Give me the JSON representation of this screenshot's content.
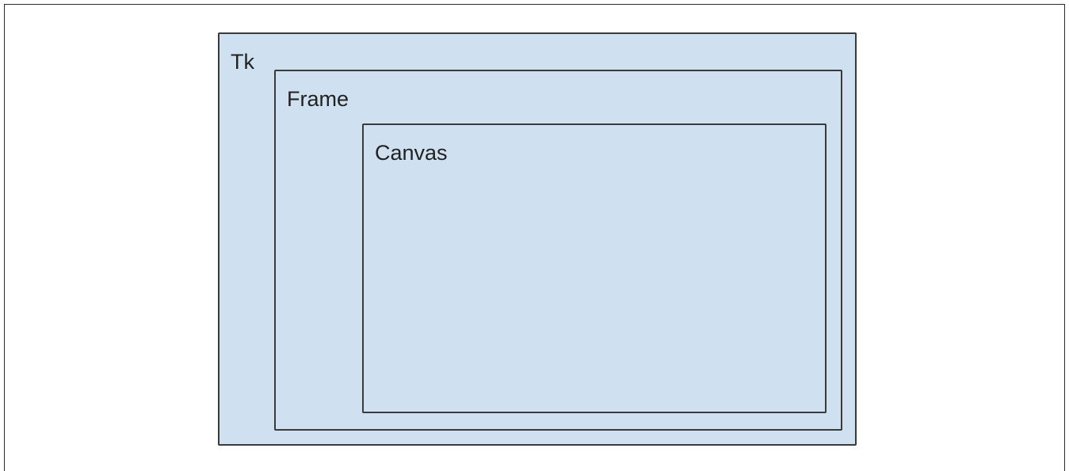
{
  "diagram": {
    "type": "nested-containers",
    "colors": {
      "box_fill": "#cfe0f1",
      "box_border": "#3a3a3a",
      "text": "#222222"
    },
    "containers": [
      {
        "id": "tk",
        "label": "Tk",
        "contains": "frame"
      },
      {
        "id": "frame",
        "label": "Frame",
        "contains": "canvas"
      },
      {
        "id": "canvas",
        "label": "Canvas",
        "contains": null
      }
    ]
  }
}
